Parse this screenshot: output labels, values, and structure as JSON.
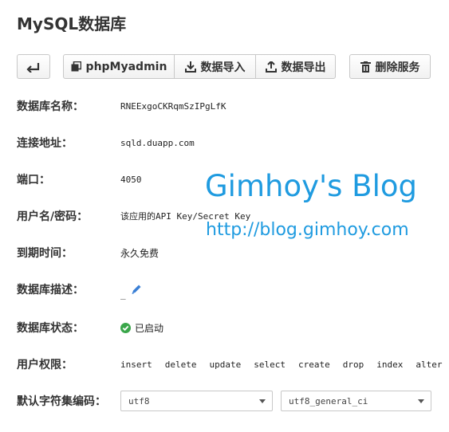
{
  "page": {
    "title": "MySQL数据库"
  },
  "toolbar": {
    "back_icon": "return-arrow-icon",
    "phpmyadmin_label": "phpMyadmin",
    "import_label": "数据导入",
    "export_label": "数据导出",
    "delete_label": "删除服务"
  },
  "details": {
    "db_name_label": "数据库名称：",
    "db_name_value": "RNEExgoCKRqmSzIPgLfK",
    "host_label": "连接地址：",
    "host_value": "sqld.duapp.com",
    "port_label": "端口：",
    "port_value": "4050",
    "credentials_label": "用户名/密码：",
    "credentials_value": "该应用的API Key/Secret Key",
    "expiry_label": "到期时间：",
    "expiry_value": "永久免费",
    "description_label": "数据库描述：",
    "description_value": "_",
    "status_label": "数据库状态：",
    "status_value": "已启动",
    "permissions_label": "用户权限：",
    "permissions": [
      "insert",
      "delete",
      "update",
      "select",
      "create",
      "drop",
      "index",
      "alter"
    ],
    "charset_label": "默认字符集编码：",
    "charset_value": "utf8",
    "collation_value": "utf8_general_ci"
  },
  "watermark": {
    "title": "Gimhoy's Blog",
    "url": "http://blog.gimhoy.com"
  },
  "colors": {
    "status_ok": "#3aa64a",
    "watermark": "#1f9be0",
    "edit_icon": "#3a7fd5"
  }
}
